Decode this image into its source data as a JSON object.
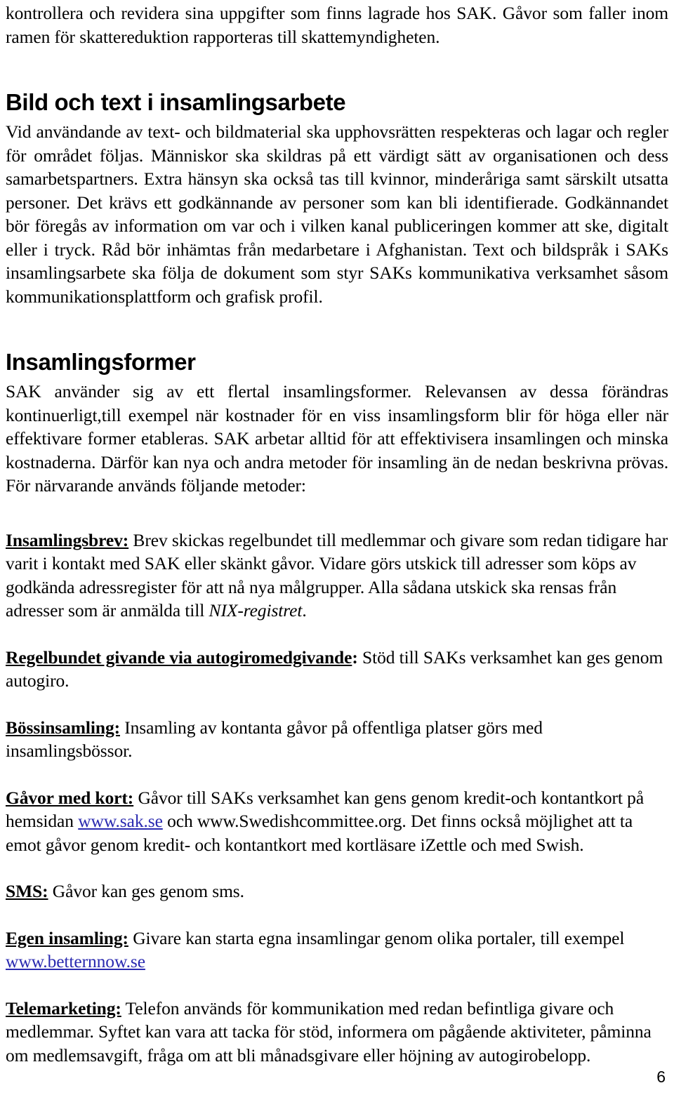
{
  "document": {
    "page_number": "6",
    "language": "sv",
    "link_color": "#2a2ab0",
    "text_color": "#000000",
    "background_color": "#ffffff"
  },
  "intro_paragraph": {
    "text": "kontrollera och revidera sina uppgifter som finns lagrade hos SAK. Gåvor som faller inom ramen för skattereduktion rapporteras till skattemyndigheten."
  },
  "sections": {
    "bild_och_text": {
      "heading": "Bild och text i insamlingsarbete",
      "body": "Vid användande av text- och bildmaterial ska upphovsrätten respekteras och lagar och regler för området följas. Människor ska skildras på ett värdigt sätt av organisationen och dess samarbetspartners. Extra hänsyn ska också tas till kvinnor, minderåriga samt särskilt utsatta personer. Det krävs ett godkännande av personer som kan bli identifierade. Godkännandet bör föregås av information om var och i vilken kanal publiceringen kommer att ske, digitalt eller i tryck. Råd bör inhämtas från medarbetare i Afghanistan. Text och bildspråk i SAKs insamlingsarbete ska följa de dokument som styr SAKs kommunikativa verksamhet såsom kommunikationsplattform och grafisk profil."
    },
    "insamlingsformer": {
      "heading": "Insamlingsformer",
      "body": "SAK använder sig av ett flertal insamlingsformer. Relevansen av dessa förändras kontinuerligt,till exempel när kostnader för en viss insamlingsform blir för höga eller när effektivare former etableras. SAK arbetar alltid för att effektivisera insamlingen och minska kostnaderna. Därför kan nya och andra metoder för insamling än de nedan beskrivna prövas. För närvarande används följande metoder:"
    }
  },
  "methods": [
    {
      "term": "Insamlingsbrev:",
      "text_before_italic": " Brev skickas regelbundet till medlemmar och givare som redan tidigare har varit i kontakt med SAK eller skänkt gåvor. Vidare görs utskick till adresser som köps av godkända adressregister för att nå nya målgrupper. Alla sådana utskick ska rensas från adresser som är anmälda till ",
      "italic_run": "NIX-registret",
      "text_after_italic": "."
    },
    {
      "term": "Regelbundet givande via autogiromedgivande",
      "term_colon": ":",
      "text": " Stöd till SAKs verksamhet kan ges genom autogiro."
    },
    {
      "term": "Bössinsamling:",
      "text": " Insamling av kontanta gåvor på offentliga platser görs med insamlingsbössor."
    },
    {
      "term": "Gåvor med kort:",
      "text_part_1": " Gåvor till SAKs verksamhet kan gens genom kredit-och kontantkort på hemsidan ",
      "link_1": "www.sak.se",
      "text_part_2": " och www.Swedishcommittee.org. Det finns också möjlighet att ta emot gåvor genom kredit- och kontantkort med kortläsare iZettle och med Swish."
    },
    {
      "term": "SMS:",
      "text": " Gåvor kan ges genom sms."
    },
    {
      "term": "Egen insamling:",
      "text_part_1": " Givare kan starta egna insamlingar genom olika portaler, till exempel ",
      "link_1": "www.betternnow.se"
    },
    {
      "term": "Telemarketing:",
      "text": " Telefon används för kommunikation med redan befintliga givare och medlemmar. Syftet kan vara att tacka för stöd, informera om pågående aktiviteter, påminna om medlemsavgift, fråga om att bli månadsgivare eller höjning av autogirobelopp."
    }
  ]
}
